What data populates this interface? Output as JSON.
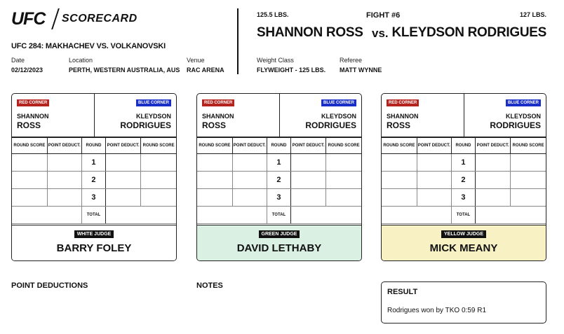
{
  "header": {
    "logo": "UFC",
    "logo_sub": "SCORECARD",
    "event": "UFC 284: MAKHACHEV VS. VOLKANOVSKI",
    "date_label": "Date",
    "date": "02/12/2023",
    "location_label": "Location",
    "location": "PERTH, WESTERN AUSTRALIA, AUS",
    "venue_label": "Venue",
    "venue": "RAC ARENA"
  },
  "fight": {
    "red_weight": "125.5 LBS.",
    "red_name": "SHANNON ROSS",
    "number": "FIGHT #6",
    "vs": "vs.",
    "blue_weight": "127 LBS.",
    "blue_name": "KLEYDSON RODRIGUES",
    "weight_class_label": "Weight Class",
    "weight_class": "FLYWEIGHT - 125 LBS.",
    "referee_label": "Referee",
    "referee": "MATT WYNNE"
  },
  "card_common": {
    "red_corner": "RED CORNER",
    "blue_corner": "BLUE CORNER",
    "red_first": "SHANNON",
    "red_last": "ROSS",
    "blue_first": "KLEYDSON",
    "blue_last": "RODRIGUES",
    "col_round_score": "ROUND SCORE",
    "col_point_deduct": "POINT DEDUCT.",
    "col_round": "ROUND",
    "rounds": [
      "1",
      "2",
      "3"
    ],
    "total": "TOTAL"
  },
  "cards": [
    {
      "judge_tag": "WHITE JUDGE",
      "judge_name": "BARRY FOLEY",
      "bg": "#ffffff"
    },
    {
      "judge_tag": "GREEN JUDGE",
      "judge_name": "DAVID LETHABY",
      "bg": "#d9f0e3"
    },
    {
      "judge_tag": "YELLOW JUDGE",
      "judge_name": "MICK MEANY",
      "bg": "#f8f1c4"
    }
  ],
  "footer": {
    "point_deductions": "POINT DEDUCTIONS",
    "notes": "NOTES",
    "result_title": "RESULT",
    "result_text": "Rodrigues won by TKO 0:59 R1"
  }
}
